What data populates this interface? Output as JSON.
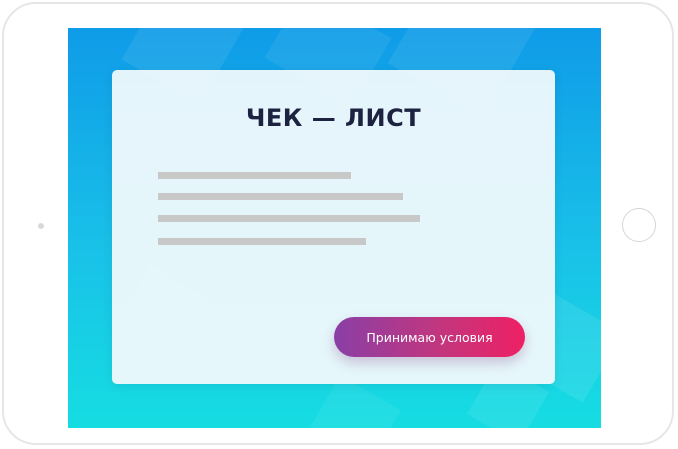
{
  "card": {
    "title": "ЧЕК — ЛИСТ",
    "placeholder_lines": 4
  },
  "button": {
    "label": "Принимаю условия"
  },
  "colors": {
    "screen_top": "#0f9be8",
    "screen_bottom": "#16dde2",
    "title": "#1c2240",
    "button_start": "#8a3fa6",
    "button_end": "#ee2064",
    "placeholder_line": "#c8c8c8"
  }
}
